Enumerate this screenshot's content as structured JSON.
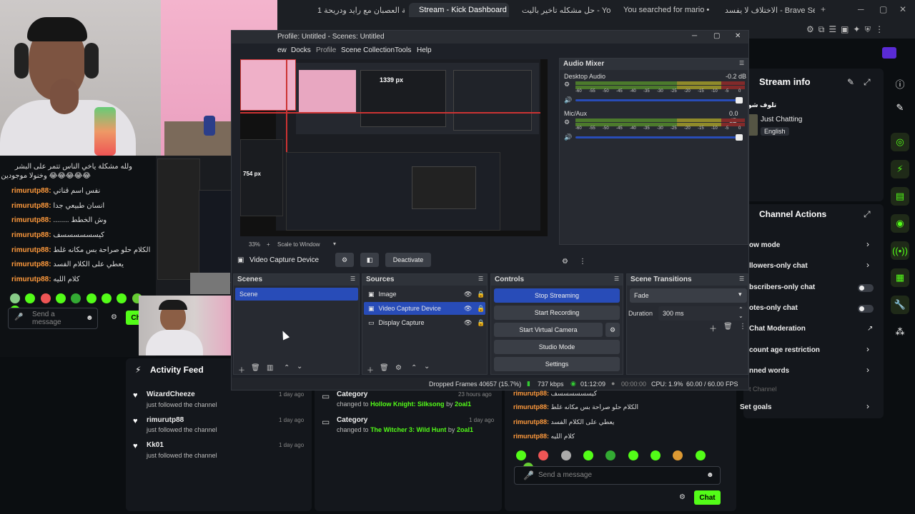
{
  "browser": {
    "tabs": [
      {
        "label": "مصارعة العصبان مع رايد ودريحة 1"
      },
      {
        "label": "Stream - Kick Dashboard"
      },
      {
        "label": "حل مشكله تاخير باليت - YouTube"
      },
      {
        "label": "You searched for mario • Stea"
      },
      {
        "label": "الاختلاف لا يفسد - Brave Search"
      }
    ]
  },
  "colors": {
    "kick_green": "#53fc18",
    "obs_select": "#284cb8",
    "chat_user": "#ff9a3c"
  },
  "chat": {
    "lines": [
      {
        "user": "",
        "msg": "ولله مشكلة ياخي الناس تتمر على البشر"
      },
      {
        "user": "",
        "msg": "😂😂😂😂😂 وخنولا موجودين"
      },
      {
        "user": "rimurutp88:",
        "msg": "نفس اسم قناتي"
      },
      {
        "user": "rimurutp88:",
        "msg": "انسان طبيعي جدا"
      },
      {
        "user": "rimurutp88:",
        "msg": "........ وش الخطط"
      },
      {
        "user": "rimurutp88:",
        "msg": "كيسسسسسسف"
      },
      {
        "user": "rimurutp88:",
        "msg": "الكلام حلو صراحة بس مكانه غلط"
      },
      {
        "user": "rimurutp88:",
        "msg": "يعطي على الكلام الفسد"
      },
      {
        "user": "rimurutp88:",
        "msg": "كلام الليه"
      }
    ],
    "input_placeholder": "Send a message",
    "chat_button": "Chat"
  },
  "obs": {
    "title": "Profile: Untitled - Scenes: Untitled",
    "menu": [
      "ew",
      "Docks",
      "Profile",
      "Scene Collection",
      "Tools",
      "Help"
    ],
    "zoom": "33%",
    "scale": "Scale to Window",
    "preview_measure_1": "1339 px",
    "preview_measure_2": "754 px",
    "source_toolbar": {
      "name": "Video Capture Device",
      "deactivate": "Deactivate"
    },
    "audio_mixer": {
      "title": "Audio Mixer",
      "channels": [
        {
          "name": "Desktop Audio",
          "db": "-0.2 dB"
        },
        {
          "name": "Mic/Aux",
          "db": "0.0 dB"
        }
      ],
      "scale": [
        "-60",
        "-55",
        "-50",
        "-45",
        "-40",
        "-35",
        "-30",
        "-25",
        "-20",
        "-15",
        "-10",
        "-5",
        "0"
      ]
    },
    "scenes": {
      "title": "Scenes",
      "items": [
        "Scene"
      ]
    },
    "sources": {
      "title": "Sources",
      "items": [
        "Image",
        "Video Capture Device",
        "Display Capture"
      ]
    },
    "controls": {
      "title": "Controls",
      "buttons": [
        "Stop Streaming",
        "Start Recording",
        "Start Virtual Camera",
        "Studio Mode",
        "Settings"
      ]
    },
    "transitions": {
      "title": "Scene Transitions",
      "type": "Fade",
      "duration_label": "Duration",
      "duration": "300 ms"
    },
    "status": {
      "dropped": "Dropped Frames 40657 (15.7%)",
      "bitrate": "737 kbps",
      "stream_time": "01:12:09",
      "rec_time": "00:00:00",
      "cpu": "CPU: 1.9%",
      "fps": "60.00 / 60.00 FPS"
    }
  },
  "kick": {
    "stream_info": {
      "title": "Stream info",
      "stream_title": "تلوف شو",
      "category": "Just Chatting",
      "language": "English"
    },
    "channel_actions": {
      "title": "Channel Actions",
      "items": [
        {
          "label": "ow mode"
        },
        {
          "label": "llowers-only chat"
        },
        {
          "label": "bscribers-only chat"
        },
        {
          "label": "otes-only chat"
        },
        {
          "label": "Chat Moderation"
        },
        {
          "label": "count age restriction"
        },
        {
          "label": "nned words"
        },
        {
          "label": "t Channel"
        },
        {
          "label": "Set goals"
        }
      ]
    },
    "activity_feed": {
      "title": "Activity Feed",
      "items": [
        {
          "name": "WizardCheeze",
          "text": "just followed the channel",
          "time": "1 day ago"
        },
        {
          "name": "rimurutp88",
          "text": "just followed the channel",
          "time": "1 day ago"
        },
        {
          "name": "Kk01",
          "text": "just followed the channel",
          "time": "1 day ago"
        }
      ]
    },
    "category_feed": [
      {
        "title": "Category",
        "prefix": "changed to",
        "game": "Hollow Knight: Silksong",
        "by": "by",
        "user": "2oal1",
        "time": "23 hours ago"
      },
      {
        "title": "Category",
        "prefix": "changed to",
        "game": "The Witcher 3: Wild Hunt",
        "by": "by",
        "user": "2oal1",
        "time": "1 day ago"
      }
    ],
    "chat2": {
      "lines": [
        {
          "user": "rimurutp88:",
          "msg": "كيسسسسسسف"
        },
        {
          "user": "rimurutp88:",
          "msg": "الكلام حلو صراحة بس مكانه غلط"
        },
        {
          "user": "rimurutp88:",
          "msg": "يعطي على الكلام الفسد"
        },
        {
          "user": "rimurutp88:",
          "msg": "كلام الليه"
        }
      ],
      "input_placeholder": "Send a message",
      "chat_button": "Chat"
    }
  }
}
